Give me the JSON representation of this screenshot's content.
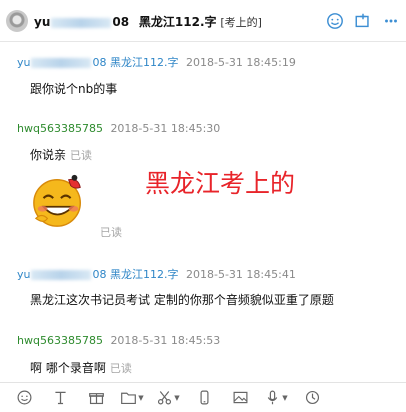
{
  "header": {
    "name_prefix": "yu",
    "name_suffix": "08",
    "group_name": "黑龙江112.字",
    "group_tag": "[考上的]"
  },
  "messages": [
    {
      "sender_prefix": "yu",
      "sender_suffix": "08 黑龙江112.字",
      "time": "2018-5-31 18:45:19",
      "text": "跟你说个nb的事",
      "read": ""
    },
    {
      "sender": "hwq563385785",
      "time": "2018-5-31 18:45:30",
      "text": "你说亲",
      "read": "已读"
    },
    {
      "sticker": "grinning-face-sticker",
      "read": "已读"
    },
    {
      "sender_prefix": "yu",
      "sender_suffix": "08 黑龙江112.字",
      "time": "2018-5-31 18:45:41",
      "text": "黑龙江这次书记员考试    定制的你那个音频貌似亚重了原题",
      "read": ""
    },
    {
      "sender": "hwq563385785",
      "time": "2018-5-31 18:45:53",
      "text": "啊   哪个录音啊",
      "read": "已读"
    }
  ],
  "overlay_text": "黑龙江考上的",
  "icons": {
    "header": [
      "emoji-icon",
      "screenshot-icon",
      "more-icon"
    ],
    "toolbar": [
      "emoji-icon",
      "font-icon",
      "gift-icon",
      "folder-icon",
      "scissors-icon",
      "phone-icon",
      "image-icon",
      "mic-icon",
      "history-icon"
    ]
  },
  "colors": {
    "accent_red": "#e8242a",
    "sender_blue": "#2f86c7",
    "sender_green": "#2e8b2e"
  }
}
